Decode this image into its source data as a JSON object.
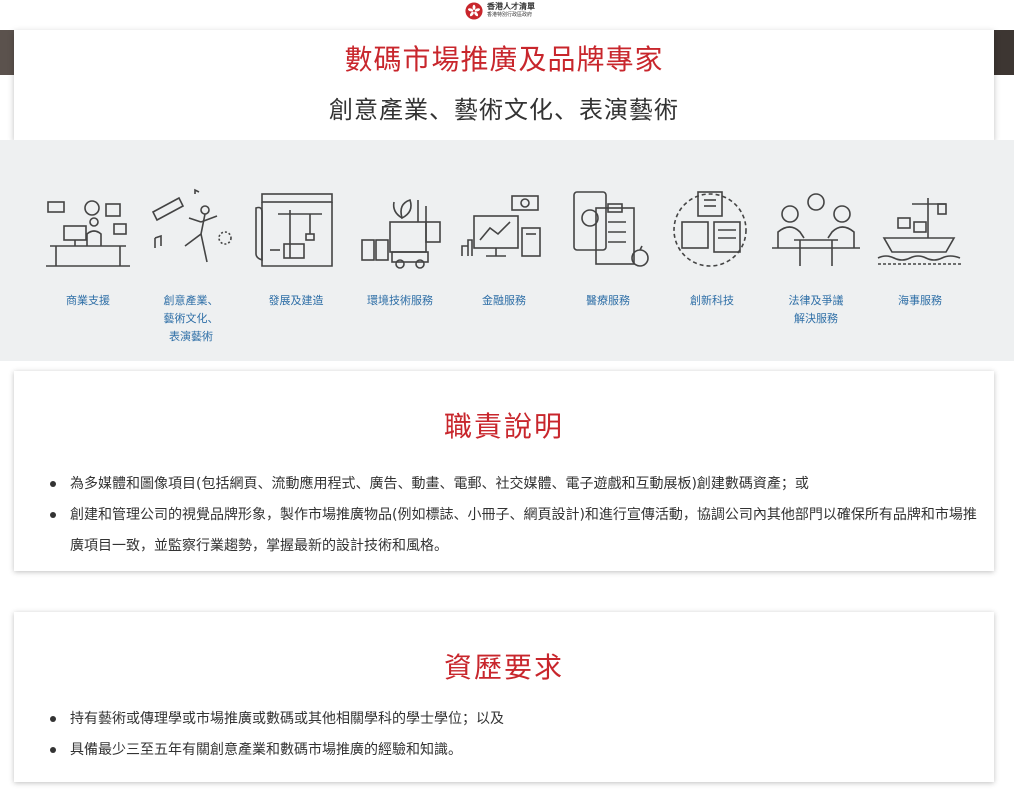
{
  "header": {
    "logo": {
      "line1": "香港人才清單",
      "line2": "香港特別行政區政府",
      "icon": "bauhinia-icon"
    }
  },
  "hero": {
    "title": "數碼市場推廣及品牌專家",
    "subtitle": "創意產業、藝術文化、表演藝術"
  },
  "sectors": [
    {
      "label": "商業支援",
      "icon": "business-support-icon"
    },
    {
      "label": "創意產業、\n藝術文化、\n表演藝術",
      "icon": "creative-arts-icon"
    },
    {
      "label": "發展及建造",
      "icon": "construction-icon"
    },
    {
      "label": "環境技術服務",
      "icon": "environment-icon"
    },
    {
      "label": "金融服務",
      "icon": "finance-icon"
    },
    {
      "label": "醫療服務",
      "icon": "medical-icon"
    },
    {
      "label": "創新科技",
      "icon": "innovation-tech-icon"
    },
    {
      "label": "法律及爭議\n解決服務",
      "icon": "legal-icon"
    },
    {
      "label": "海事服務",
      "icon": "maritime-icon"
    }
  ],
  "duties": {
    "title": "職責說明",
    "items": [
      "為多媒體和圖像項目(包括網頁、流動應用程式、廣告、動畫、電郵、社交媒體、電子遊戲和互動展板)創建數碼資產；或",
      "創建和管理公司的視覺品牌形象，製作市場推廣物品(例如標誌、小冊子、網頁設計)和進行宣傳活動，協調公司內其他部門以確保所有品牌和市場推廣項目一致，並監察行業趨勢，掌握最新的設計技術和風格。"
    ]
  },
  "requirements": {
    "title": "資歷要求",
    "items": [
      "持有藝術或傳理學或市場推廣或數碼或其他相關學科的學士學位；以及",
      "具備最少三至五年有關創意產業和數碼市場推廣的經驗和知識。"
    ]
  },
  "colors": {
    "accent_red": "#c8262c",
    "link_blue": "#2f6fa7",
    "band_grey": "#eef0f1"
  }
}
